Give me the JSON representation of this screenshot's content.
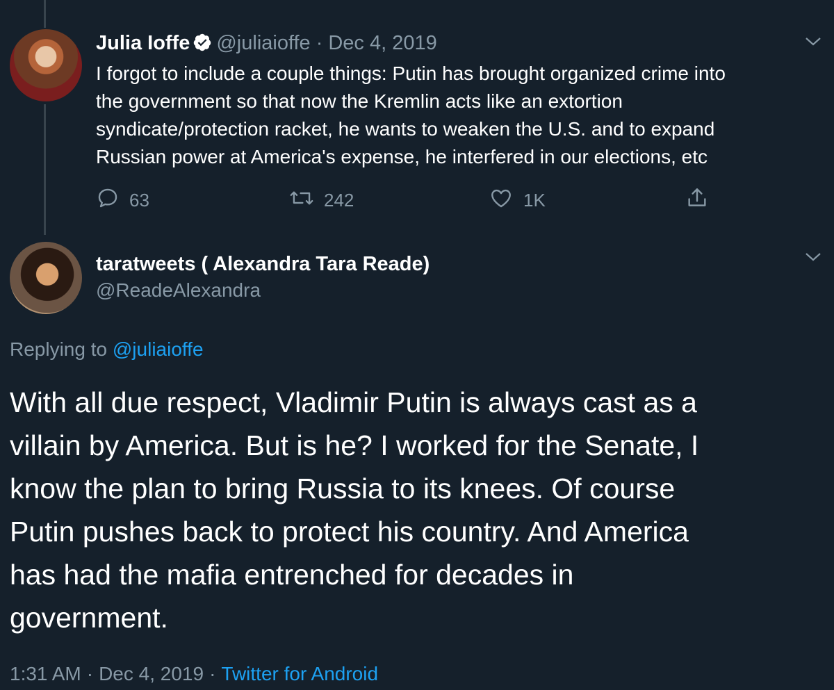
{
  "tweet1": {
    "name": "Julia Ioffe",
    "handle": "@juliaioffe",
    "dot": "·",
    "date": "Dec 4, 2019",
    "lines": [
      "I forgot to include a couple things: Putin has brought organized crime into",
      "the government so that now the Kremlin acts like an extortion",
      "syndicate/protection racket, he wants to weaken the U.S. and to expand",
      "Russian power at America's expense, he interfered in our elections, etc"
    ],
    "replies": "63",
    "retweets": "242",
    "likes": "1K"
  },
  "tweet2": {
    "name": "taratweets ( Alexandra Tara Reade)",
    "handle": "@ReadeAlexandra",
    "replying_prefix": "Replying to ",
    "replying_mention": "@juliaioffe",
    "lines": [
      "With all due respect, Vladimir Putin is always cast as a",
      "villain by America. But is he? I worked for the Senate, I",
      "know the plan to bring Russia to its knees. Of course",
      "Putin pushes back to protect his country. And America",
      "has had the mafia entrenched for decades in",
      "government."
    ],
    "time": "1:31 AM",
    "dot": "·",
    "date": "Dec 4, 2019",
    "source": "Twitter for Android"
  },
  "colors": {
    "background": "#15202b",
    "secondary_text": "#8899a6",
    "link": "#1da1f2",
    "thread_line": "#38444d"
  }
}
